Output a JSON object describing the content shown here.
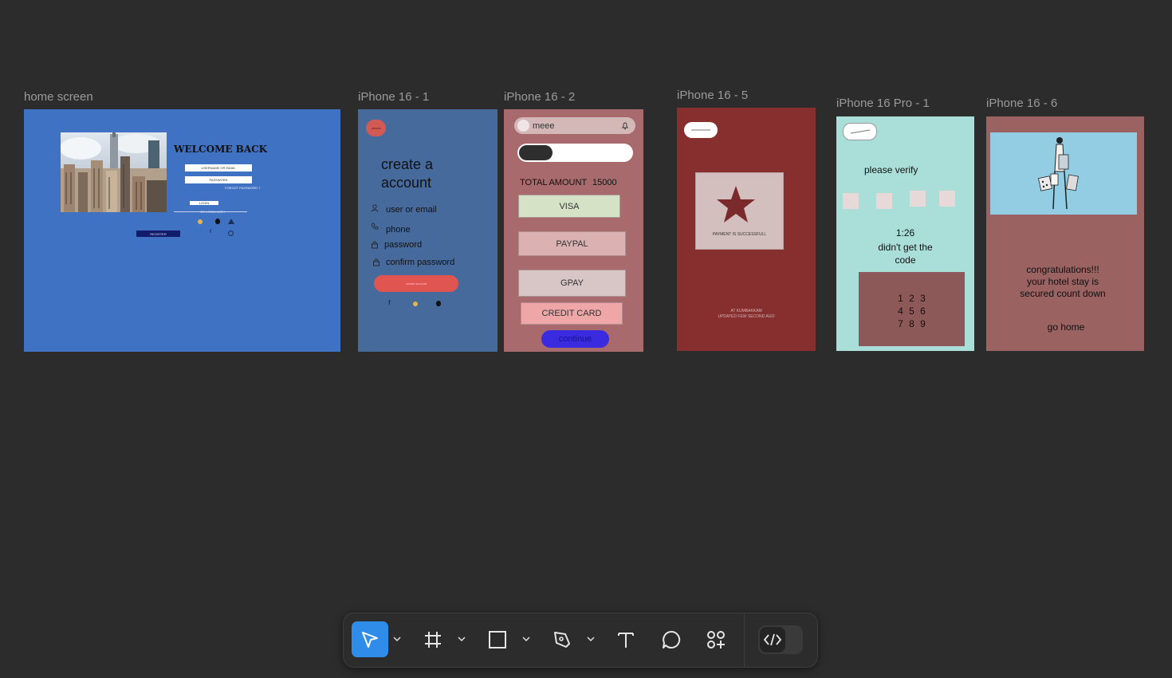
{
  "canvas": {
    "background": "#2c2c2c"
  },
  "frames": {
    "home": {
      "label": "home screen",
      "color": "#4072c4",
      "welcome": "WELCOME BACK",
      "field1": "USERNAME OR EMAIL",
      "field2": "PASSWORD",
      "forgot": "FORGOT PASSWORD ?",
      "login": "LOGIN",
      "or": "OR LOGIN WITH",
      "register": "REGISTER"
    },
    "p1": {
      "label": "iPhone 16 - 1",
      "color": "#476a9d",
      "back": "—",
      "title_line1": "create a",
      "title_line2": "account",
      "fields": [
        "user or email",
        "phone",
        "password",
        "confirm password"
      ],
      "button": "create account"
    },
    "p2": {
      "label": "iPhone 16 - 2",
      "color": "#a86a6c",
      "search_text": "meee",
      "total_label": "TOTAL AMOUNT",
      "total_value": "15000",
      "options": [
        "VISA",
        "PAYPAL",
        "GPAY",
        "CREDIT CARD"
      ],
      "continue": "continue"
    },
    "p5": {
      "label": "iPhone 16 - 5",
      "color": "#872f2e",
      "payment": "PAYMENT IS SUCCESSFULL",
      "location": "AT KUMBAKKAM",
      "updated": "UPDATED FEW SECOND AGO"
    },
    "pro1": {
      "label": "iPhone 16 Pro - 1",
      "color": "#a9dfd8",
      "verify": "please verify",
      "timer": "1:26",
      "resend_line1": "didn't get the",
      "resend_line2": "code",
      "keys": [
        "1 2 3",
        "4 5 6",
        "7 8 9"
      ]
    },
    "p6": {
      "label": "iPhone 16 - 6",
      "color": "#9b6262",
      "msg_line1": "congratulations!!!",
      "msg_line2": "your hotel stay is",
      "msg_line3": "secured count down",
      "go_home": "go home"
    }
  },
  "toolbar": {
    "accent": "#2f8ce8",
    "tools": [
      "move-tool",
      "frame-tool",
      "shape-tool",
      "pen-tool",
      "text-tool",
      "comment-tool",
      "actions-tool",
      "dev-mode-toggle"
    ]
  }
}
